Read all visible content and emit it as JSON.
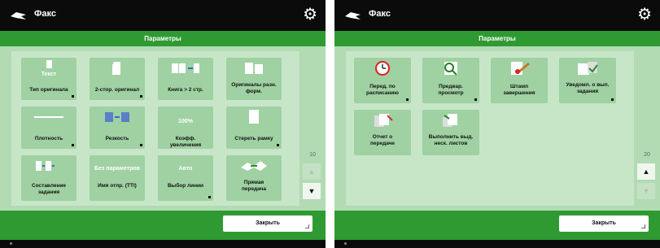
{
  "left": {
    "app_title": "Факс",
    "subheader": "Параметры",
    "tiles": [
      {
        "sub": "Текст",
        "label": "Тип оригинала"
      },
      {
        "sub": "",
        "label": "2-стор. оригинал"
      },
      {
        "sub": "",
        "label": "Книга > 2 стр."
      },
      {
        "sub": "",
        "label": "Оригиналы разн.\nформ."
      },
      {
        "sub": "",
        "label": "Плотность"
      },
      {
        "sub": "",
        "label": "Резкость"
      },
      {
        "sub": "100%",
        "label": "Коэфф. увеличения"
      },
      {
        "sub": "",
        "label": "Стереть рамку"
      },
      {
        "sub": "",
        "label": "Составление\nзадания"
      },
      {
        "sub": "Без параметров",
        "label": "Имя отпр. (TTI)"
      },
      {
        "sub": "Авто",
        "label": "Выбор линии"
      },
      {
        "sub": "",
        "label": "Прямая\nпередача"
      }
    ],
    "page_number": "10",
    "close_label": "Закрыть"
  },
  "right": {
    "app_title": "Факс",
    "subheader": "Параметры",
    "tiles": [
      {
        "sub": "",
        "label": "Перед. по\nрасписанию"
      },
      {
        "sub": "",
        "label": "Предвар.\nпросмотр"
      },
      {
        "sub": "",
        "label": "Штамп\nзавершения"
      },
      {
        "sub": "",
        "label": "Уведомл. о вып.\nзадания"
      },
      {
        "sub": "",
        "label": "Отчет о\nпередаче"
      },
      {
        "sub": "",
        "label": "Выполнить выд.\nнеск. листов"
      }
    ],
    "page_number": "20",
    "close_label": "Закрыть"
  }
}
